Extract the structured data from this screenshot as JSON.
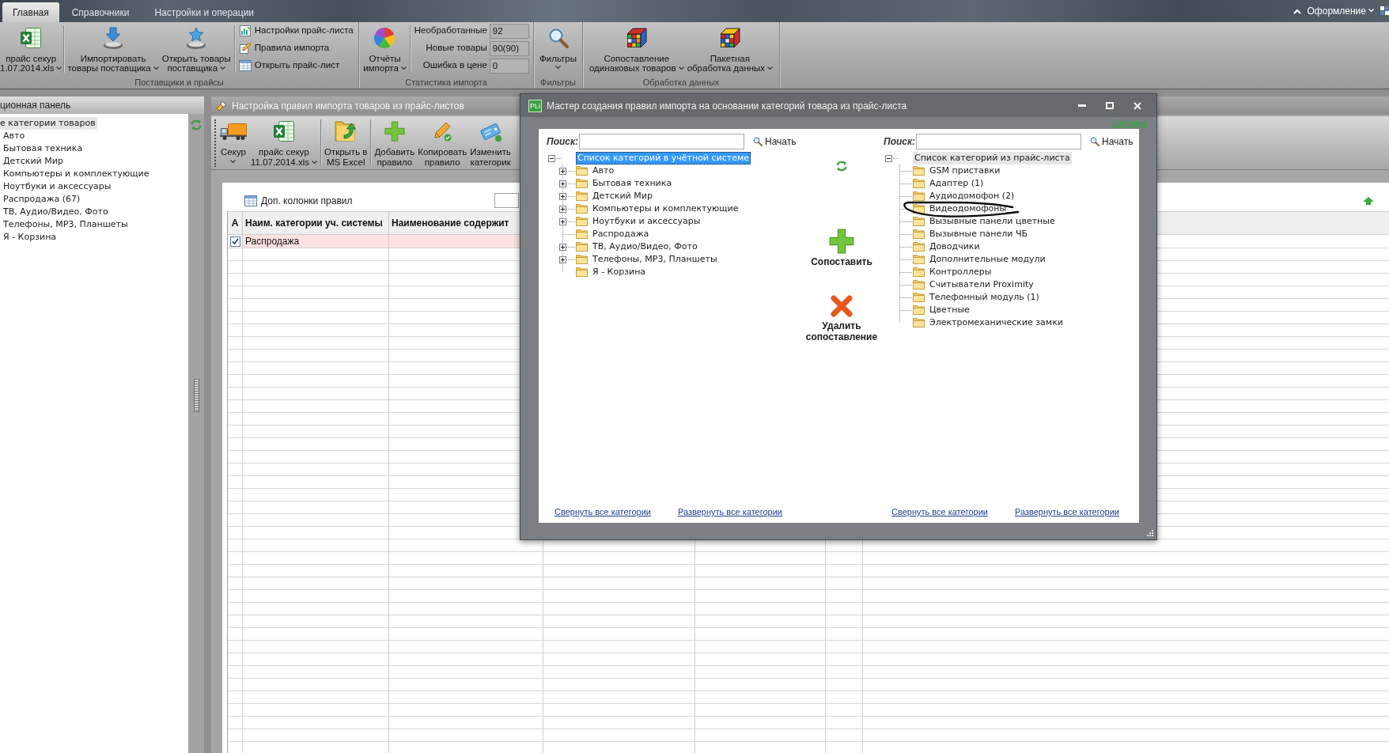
{
  "ribbon_tabs": [
    {
      "label": "Главная",
      "selected": true
    },
    {
      "label": "Справочники",
      "selected": false
    },
    {
      "label": "Настройки и операции",
      "selected": false
    }
  ],
  "layout_menu": {
    "label": "Оформление",
    "dropdown": true
  },
  "ribbon_groups": [
    {
      "label": "Поставщики и прайсы",
      "buttons": [
        {
          "lines": [
            "прайс секур",
            "1.07.2014.xls"
          ],
          "dropdown": true,
          "separator": true
        },
        {
          "lines": [
            "Импортировать",
            "товары поставщика"
          ],
          "dropdown": true,
          "separator": false
        },
        {
          "lines": [
            "Открыть товары",
            "поставщика"
          ],
          "dropdown": true,
          "separator": false
        }
      ],
      "small_buttons": [
        "Настройки прайс-листа",
        "Правила импорта",
        "Открыть прайс-лист"
      ]
    },
    {
      "label": "Статистика импорта",
      "buttons": [
        {
          "lines": [
            "Отчёты",
            "импорта"
          ],
          "dropdown": true,
          "separator": false
        }
      ],
      "stats": [
        {
          "label": "Необработанные",
          "value": "92"
        },
        {
          "label": "Новые товары",
          "value": "90(90)"
        },
        {
          "label": "Ошибка в цене",
          "value": "0"
        }
      ]
    },
    {
      "label": "Фильтры",
      "buttons": [
        {
          "lines": [
            "Фильтры"
          ],
          "dropdown": true,
          "separator": false
        }
      ]
    },
    {
      "label": "Обработка данных",
      "buttons": [
        {
          "lines": [
            "Сопоставление",
            "одинаковых товаров"
          ],
          "dropdown": true,
          "separator": false
        },
        {
          "lines": [
            "Пакетная",
            "обработка данных"
          ],
          "dropdown": true,
          "separator": false
        }
      ]
    }
  ],
  "nav_panel": {
    "title": "ционная панель",
    "tree": {
      "label": "е категории товаров",
      "selected": true,
      "focused": false,
      "children": [
        {
          "label": "Авто",
          "selected": false
        },
        {
          "label": "Бытовая техника",
          "selected": false
        },
        {
          "label": "Детский Мир",
          "selected": false
        },
        {
          "label": "Компьютеры и комплектующие",
          "selected": false
        },
        {
          "label": "Ноутбуки и аксессуары",
          "selected": false
        },
        {
          "label": "Распродажа (67)",
          "selected": false
        },
        {
          "label": "ТВ, Аудио/Видео, Фото",
          "selected": false
        },
        {
          "label": "Телефоны, MP3, Планшеты",
          "selected": false
        },
        {
          "label": "Я - Корзина",
          "selected": false
        }
      ]
    }
  },
  "document": {
    "title": "Настройка правил импорта товаров из прайс-листов",
    "toolbar": [
      {
        "lines": [
          "Секур"
        ],
        "dropdown": true,
        "separator": false
      },
      {
        "lines": [
          "прайс секур",
          "11.07.2014.xls"
        ],
        "dropdown": true,
        "separator": true
      },
      {
        "lines": [
          "Открыть в",
          "MS Excel"
        ],
        "dropdown": false,
        "separator": true
      },
      {
        "lines": [
          "Добавить",
          "правило"
        ],
        "dropdown": false,
        "separator": false
      },
      {
        "lines": [
          "Копировать",
          "правило"
        ],
        "dropdown": false,
        "separator": false
      },
      {
        "lines": [
          "Изменить",
          "категорик"
        ],
        "dropdown": false,
        "separator": false
      }
    ],
    "extra_columns_button": "Доп. колонки правил",
    "table": {
      "columns": [
        "А",
        "Наим. категории уч. системы",
        "Наименование содержит"
      ],
      "rows": [
        {
          "checked": true,
          "selected": true,
          "cells": [
            "",
            "Распродажа"
          ]
        }
      ]
    }
  },
  "dialog": {
    "app_icon_text": "PLi",
    "title": "Мастер создания правил импорта на основании категорий товара из прайс-листа",
    "help_link": "Справка",
    "panes": [
      {
        "search_label": "Поиск:",
        "search_button": "Начать",
        "tree": {
          "label": "Список категорий в учётной системе",
          "expandable": true,
          "expanded": true,
          "selected": true,
          "focused": true,
          "children": [
            {
              "label": "Авто",
              "expandable": true,
              "expanded": false,
              "selected": false
            },
            {
              "label": "Бытовая техника",
              "expandable": true,
              "expanded": false,
              "selected": false
            },
            {
              "label": "Детский Мир",
              "expandable": true,
              "expanded": false,
              "selected": false
            },
            {
              "label": "Компьютеры и комплектующие",
              "expandable": true,
              "expanded": false,
              "selected": false
            },
            {
              "label": "Ноутбуки и аксессуары",
              "expandable": true,
              "expanded": false,
              "selected": false
            },
            {
              "label": "Распродажа",
              "expandable": false,
              "selected": false
            },
            {
              "label": "ТВ, Аудио/Видео, Фото",
              "expandable": true,
              "expanded": false,
              "selected": false
            },
            {
              "label": "Телефоны, MP3, Планшеты",
              "expandable": true,
              "expanded": false,
              "selected": false
            },
            {
              "label": "Я - Корзина",
              "expandable": false,
              "selected": false
            }
          ]
        },
        "links": [
          "Свернуть все категории",
          "Развернуть все категории"
        ]
      },
      {
        "search_label": "Поиск:",
        "search_button": "Начать",
        "tree": {
          "label": "Список категорий из прайс-листа",
          "expandable": true,
          "expanded": true,
          "selected": true,
          "focused": false,
          "children": [
            {
              "label": "GSM приставки",
              "expandable": false,
              "selected": false
            },
            {
              "label": "Адаптер (1)",
              "expandable": false,
              "selected": false
            },
            {
              "label": "Аудиодомофон (2)",
              "expandable": false,
              "selected": false
            },
            {
              "label": "Видеодомофоны",
              "expandable": false,
              "selected": false
            },
            {
              "label": "Вызывные панели цветные",
              "expandable": false,
              "selected": false
            },
            {
              "label": "Вызывные панели ЧБ",
              "expandable": false,
              "selected": false
            },
            {
              "label": "Доводчики",
              "expandable": false,
              "selected": false
            },
            {
              "label": "Дополнительные модули",
              "expandable": false,
              "selected": false
            },
            {
              "label": "Контроллеры",
              "expandable": false,
              "selected": false
            },
            {
              "label": "Считыватели  Proximity",
              "expandable": false,
              "selected": false
            },
            {
              "label": "Телефонный модуль (1)",
              "expandable": false,
              "selected": false
            },
            {
              "label": "Цветные",
              "expandable": false,
              "selected": false
            },
            {
              "label": "Электромеханические замки",
              "expandable": false,
              "selected": false
            }
          ]
        },
        "links": [
          "Свернуть все категории",
          "Развернуть все категории"
        ]
      }
    ],
    "actions": [
      {
        "lines": [
          "Сопоставить"
        ]
      },
      {
        "lines": [
          "Удалить",
          "сопоставление"
        ]
      }
    ]
  }
}
